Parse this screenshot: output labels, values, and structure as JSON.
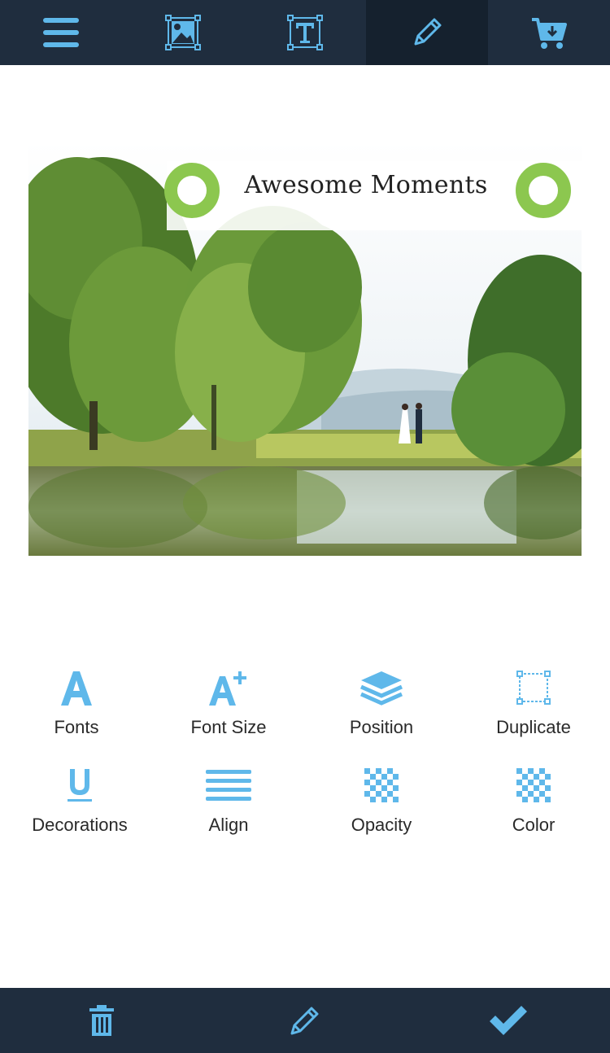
{
  "topbar": {
    "items": [
      {
        "icon": "menu-icon"
      },
      {
        "icon": "image-icon"
      },
      {
        "icon": "text-icon"
      },
      {
        "icon": "pencil-icon",
        "active": true
      },
      {
        "icon": "cart-icon"
      }
    ],
    "icon_color": "#5fb8ea",
    "bg_color": "#1f2d3e"
  },
  "design": {
    "title_text": "Awesome Moments",
    "handle_color": "#8cc74f"
  },
  "tools": [
    {
      "label": "Fonts",
      "icon": "font-icon"
    },
    {
      "label": "Font Size",
      "icon": "font-size-icon"
    },
    {
      "label": "Position",
      "icon": "layers-icon"
    },
    {
      "label": "Duplicate",
      "icon": "duplicate-icon"
    },
    {
      "label": "Decorations",
      "icon": "underline-icon"
    },
    {
      "label": "Align",
      "icon": "align-icon"
    },
    {
      "label": "Opacity",
      "icon": "checker-icon"
    },
    {
      "label": "Color",
      "icon": "checker-icon"
    }
  ],
  "bottombar": {
    "items": [
      {
        "icon": "trash-icon"
      },
      {
        "icon": "pencil-icon"
      },
      {
        "icon": "check-icon"
      }
    ]
  }
}
